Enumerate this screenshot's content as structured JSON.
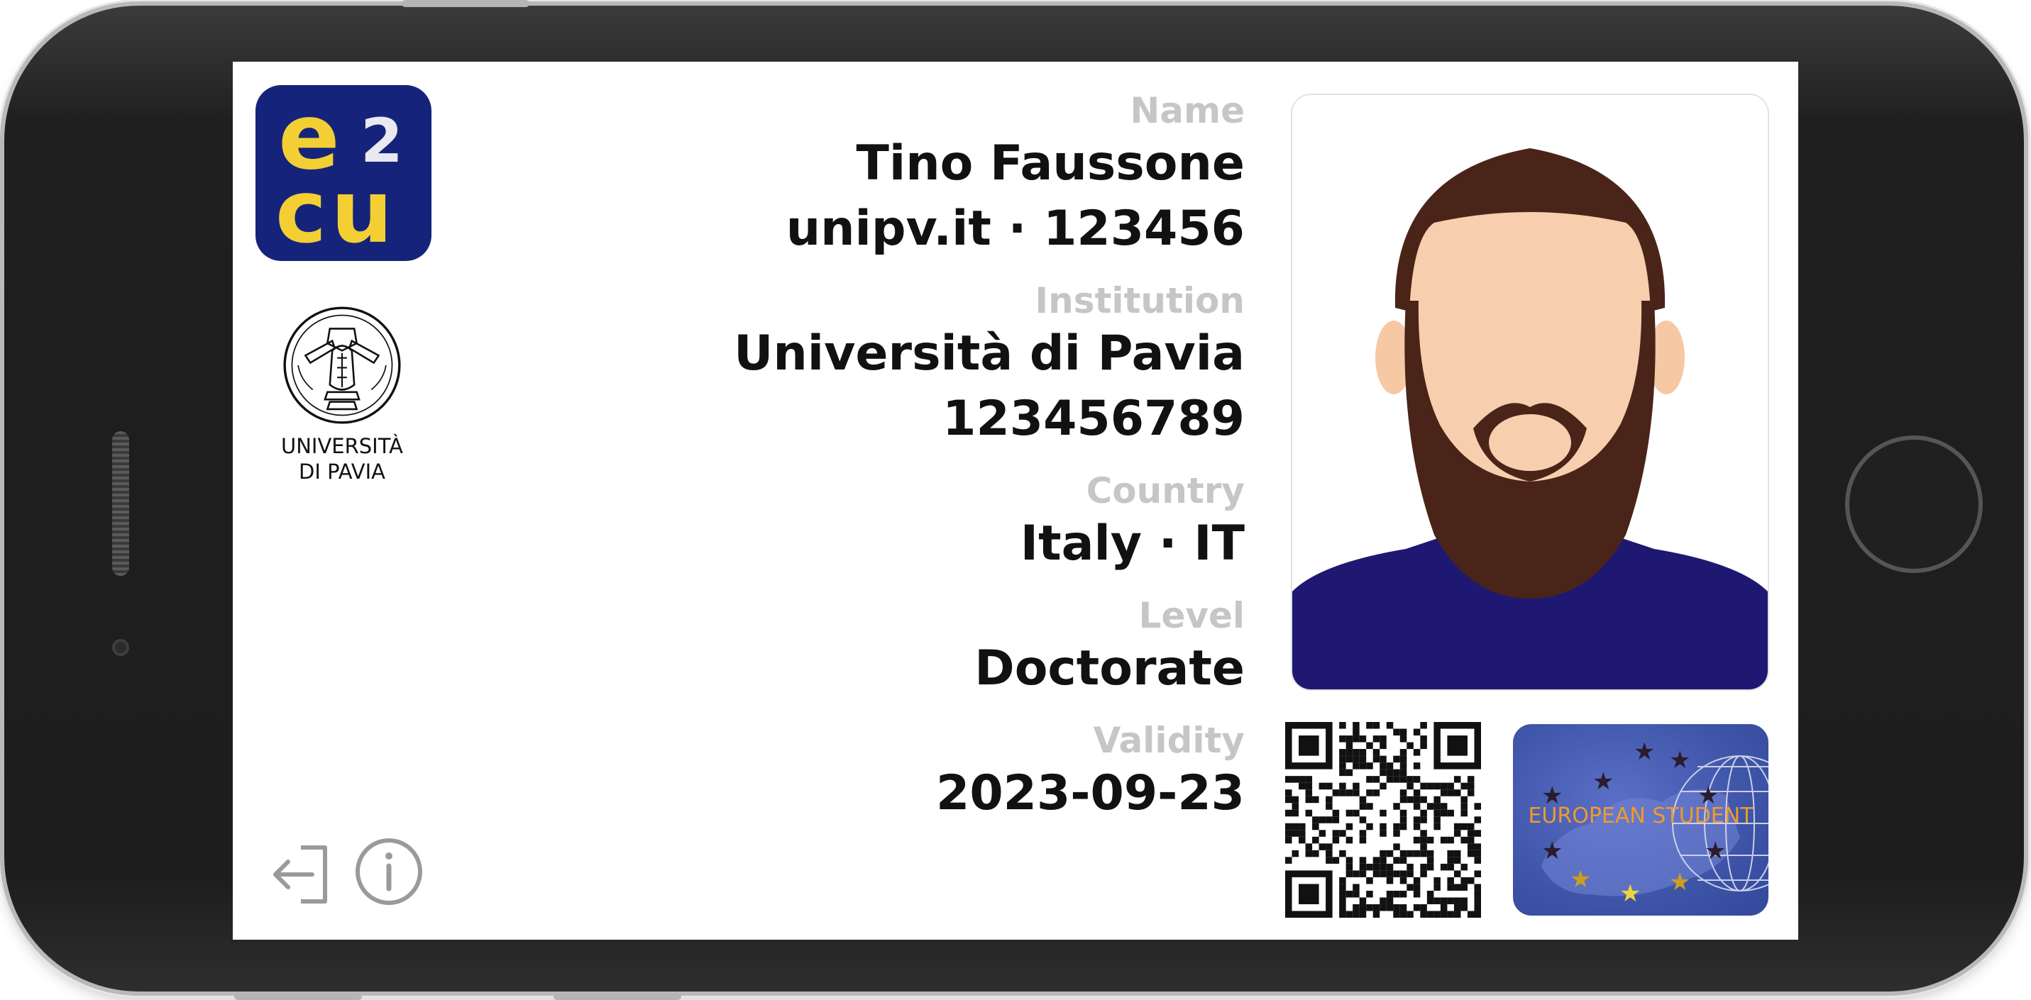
{
  "card": {
    "logo": {
      "e": "e",
      "two": "2",
      "cu": "cu"
    },
    "institution_logo": {
      "line1": "UNIVERSITÀ",
      "line2": "DI PAVIA"
    },
    "fields": [
      {
        "label": "Name",
        "values": [
          "Tino Faussone",
          "unipv.it · 123456"
        ]
      },
      {
        "label": "Institution",
        "values": [
          "Università di Pavia",
          "123456789"
        ]
      },
      {
        "label": "Country",
        "values": [
          "Italy · IT"
        ]
      },
      {
        "label": "Level",
        "values": [
          "Doctorate"
        ]
      },
      {
        "label": "Validity",
        "values": [
          "2023-09-23"
        ]
      }
    ],
    "badge": {
      "text": "EUROPEAN STUDENT"
    },
    "actions": {
      "logout_icon": "logout-icon",
      "info_icon": "info-icon"
    }
  },
  "colors": {
    "logo_bg": "#15247a",
    "logo_accent": "#f4cf34",
    "label_gray": "#c6c6c6",
    "value_black": "#111111",
    "beard": "#4a2418",
    "skin": "#f8cfae",
    "shirt": "#1e1872",
    "badge_blue": "#3f55a8",
    "badge_text": "#f19a2a"
  }
}
